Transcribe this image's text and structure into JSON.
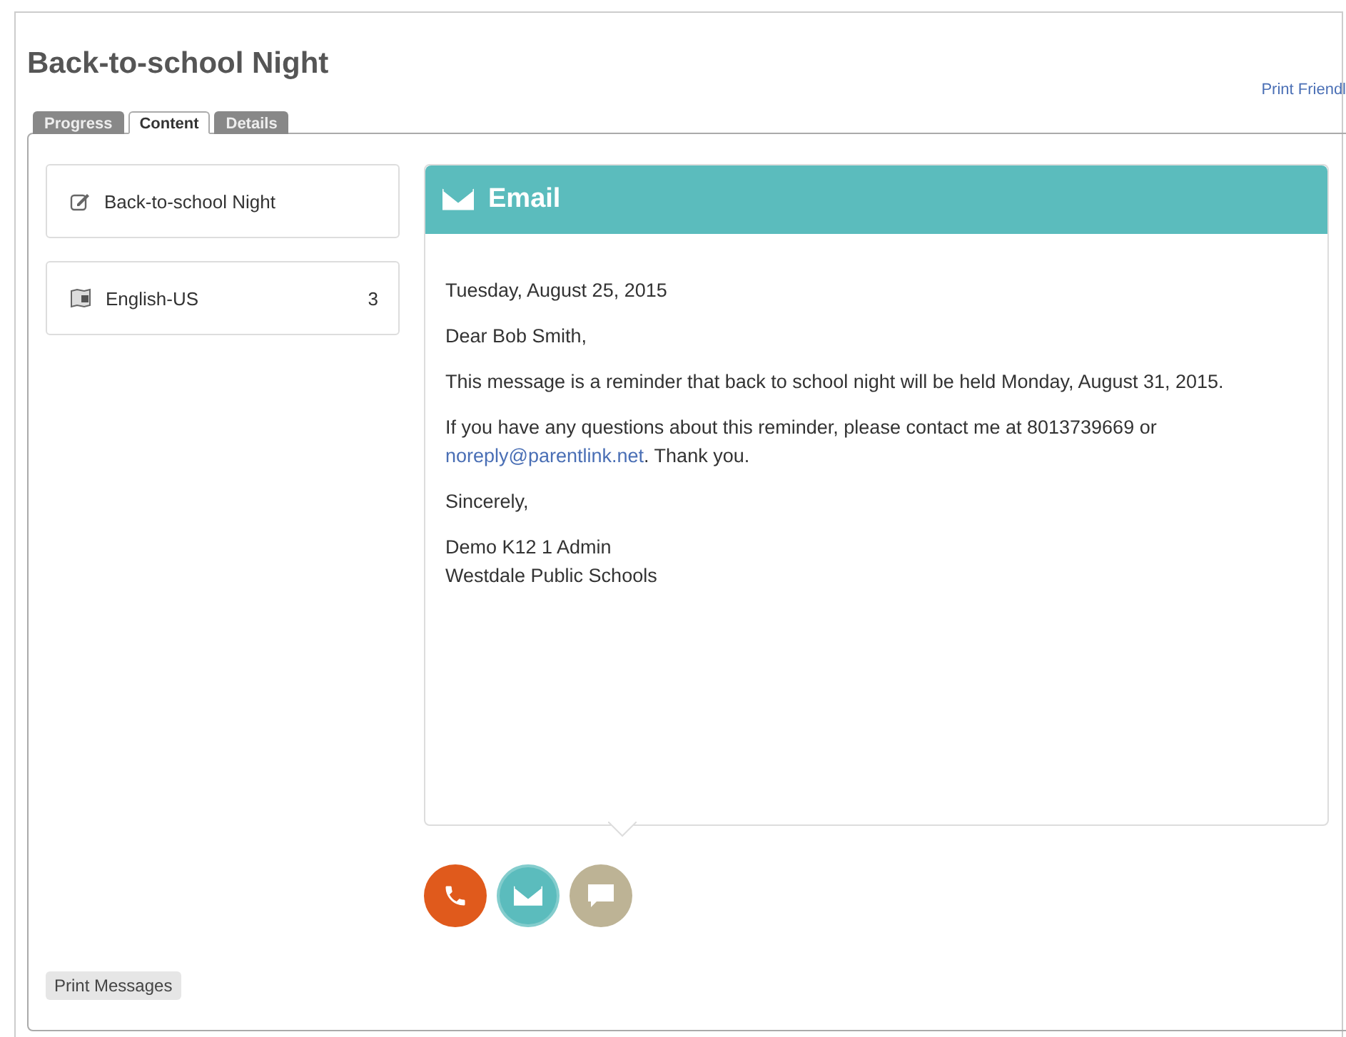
{
  "title": "Back-to-school Night",
  "print_link": "Print Friendl",
  "tabs": [
    {
      "label": "Progress",
      "selected": false
    },
    {
      "label": "Content",
      "selected": true
    },
    {
      "label": "Details",
      "selected": false
    }
  ],
  "sidebar": [
    {
      "kind": "message",
      "label": "Back-to-school Night"
    },
    {
      "kind": "language",
      "label": "English-US",
      "count": "3"
    }
  ],
  "email": {
    "heading": "Email",
    "paragraphs": [
      {
        "lines": [
          "Tuesday, August 25, 2015"
        ]
      },
      {
        "lines": [
          "Dear Bob Smith,"
        ]
      },
      {
        "lines": [
          "This message is a reminder that back to school night will be held Monday, August 31, 2015."
        ]
      },
      {
        "text": "If you have any questions about this reminder, please contact me at 8013739669 or",
        "link": "noreply@parentlink.net",
        "after": ". Thank you."
      },
      {
        "lines": [
          "Sincerely,"
        ]
      },
      {
        "lines": [
          "Demo K12 1 Admin",
          "Westdale Public Schools"
        ]
      }
    ]
  },
  "channels": [
    {
      "kind": "phone",
      "color": "#e05a1c",
      "selected": false
    },
    {
      "kind": "email",
      "color": "#5bbcbd",
      "selected": true
    },
    {
      "kind": "sms",
      "color": "#bdb395",
      "selected": false
    }
  ],
  "print_button": "Print Messages"
}
